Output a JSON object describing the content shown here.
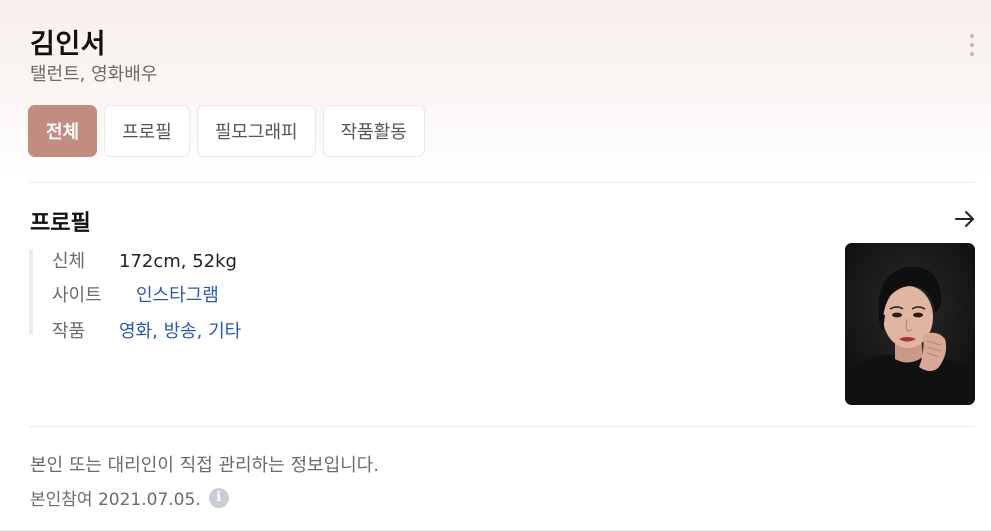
{
  "header": {
    "name": "김인서",
    "subtitle": "탤런트, 영화배우"
  },
  "tabs": [
    {
      "label": "전체",
      "active": true
    },
    {
      "label": "프로필",
      "active": false
    },
    {
      "label": "필모그래피",
      "active": false
    },
    {
      "label": "작품활동",
      "active": false
    }
  ],
  "profile": {
    "title": "프로필",
    "rows": [
      {
        "label": "신체",
        "value": "172cm, 52kg"
      },
      {
        "label": "사이트",
        "value": "인스타그램"
      },
      {
        "label": "작품",
        "value": "영화, 방송, 기타"
      }
    ]
  },
  "footer": {
    "notice": "본인 또는 대리인이 직접 관리하는 정보입니다.",
    "joined": "본인참여 2021.07.05."
  },
  "icons": {
    "more": "more-vertical-icon",
    "arrow": "arrow-right-icon",
    "info": "info-icon"
  },
  "colors": {
    "accent": "#c08d80",
    "link": "#2a5aa8"
  }
}
